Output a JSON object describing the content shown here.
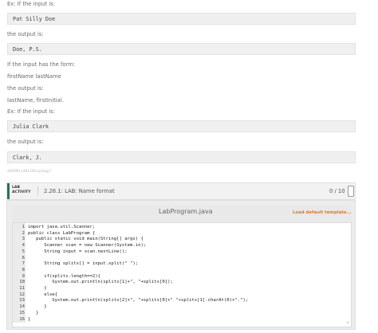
{
  "instructions": {
    "ex_input_1": "Ex: If the input is:",
    "example_input_1": "Pat Silly Doe",
    "output_is_1": "the output is:",
    "example_output_1": "Doe, P.S.",
    "form_label": "If the input has the form:",
    "form_value": "firstName lastName",
    "output_is_2": "the output is:",
    "form_output": "lastName, firstInitial.",
    "ex_input_2": "Ex: If the input is:",
    "example_input_2": "Julia Clark",
    "output_is_3": "the output is:",
    "example_output_2": "Clark, J.",
    "activity_id": "466094.1481328.qx3zqy7"
  },
  "lab": {
    "badge_line1": "LAB",
    "badge_line2": "ACTIVITY",
    "title": "2.26.1: LAB: Name format",
    "score": "0 / 10"
  },
  "editor": {
    "file_name": "LabProgram.java",
    "load_template": "Load default template...",
    "lines": [
      {
        "n": "1",
        "code": "import java.util.Scanner;"
      },
      {
        "n": "2",
        "code": "public class LabProgram {"
      },
      {
        "n": "3",
        "code": "   public static void main(String[] args) {"
      },
      {
        "n": "4",
        "code": "      Scanner scan = new Scanner(System.in);"
      },
      {
        "n": "5",
        "code": "      String input = scan.nextLine();"
      },
      {
        "n": "6",
        "code": ""
      },
      {
        "n": "7",
        "code": "      String splits[] = input.split(\" \");"
      },
      {
        "n": "8",
        "code": ""
      },
      {
        "n": "9",
        "code": "      if(splits.length==2){"
      },
      {
        "n": "10",
        "code": "         System.out.println(splits[1]+\", \"+splits[0]);"
      },
      {
        "n": "11",
        "code": "      }"
      },
      {
        "n": "12",
        "code": "      else{"
      },
      {
        "n": "13",
        "code": "         System.out.println(splits[2]+\", \"+splits[0]+\" \"+splits[1].charAt(0)+\".\");"
      },
      {
        "n": "14",
        "code": "      }"
      },
      {
        "n": "15",
        "code": "   }"
      },
      {
        "n": "16",
        "code": "}"
      }
    ]
  },
  "colors": {
    "accent": "#1f7a4d",
    "link": "#e07b20"
  }
}
